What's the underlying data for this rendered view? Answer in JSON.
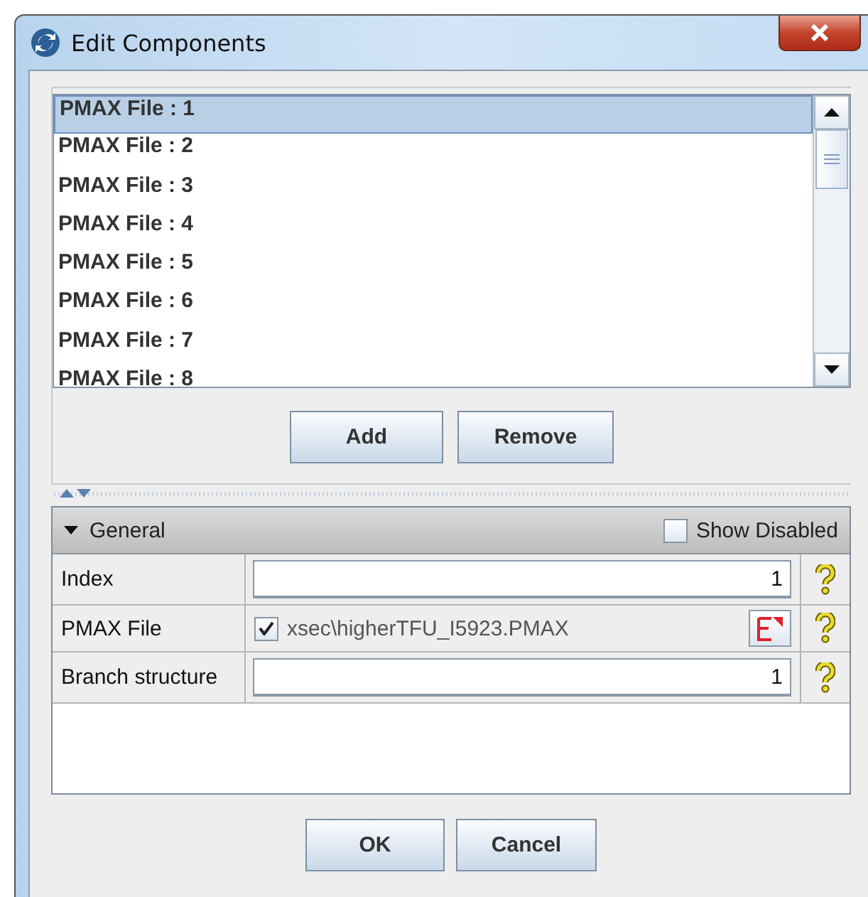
{
  "window": {
    "title": "Edit Components"
  },
  "components": [
    {
      "label": "PMAX File : 1",
      "selected": true
    },
    {
      "label": "PMAX File : 2",
      "selected": false
    },
    {
      "label": "PMAX File : 3",
      "selected": false
    },
    {
      "label": "PMAX File : 4",
      "selected": false
    },
    {
      "label": "PMAX File : 5",
      "selected": false
    },
    {
      "label": "PMAX File : 6",
      "selected": false
    },
    {
      "label": "PMAX File : 7",
      "selected": false
    },
    {
      "label": "PMAX File : 8",
      "selected": false
    }
  ],
  "list_buttons": [
    "Add",
    "Remove"
  ],
  "properties": {
    "section": "General",
    "expanded": true,
    "show_disabled": {
      "label": "Show Disabled",
      "checked": false
    },
    "rows": [
      {
        "kind": "text",
        "label": "Index",
        "value": "1"
      },
      {
        "kind": "file",
        "label": "PMAX File",
        "checked": true,
        "value": "xsec\\higherTFU_I5923.PMAX"
      },
      {
        "kind": "text",
        "label": "Branch structure",
        "value": "1"
      }
    ]
  },
  "buttons": [
    "OK",
    "Cancel"
  ]
}
